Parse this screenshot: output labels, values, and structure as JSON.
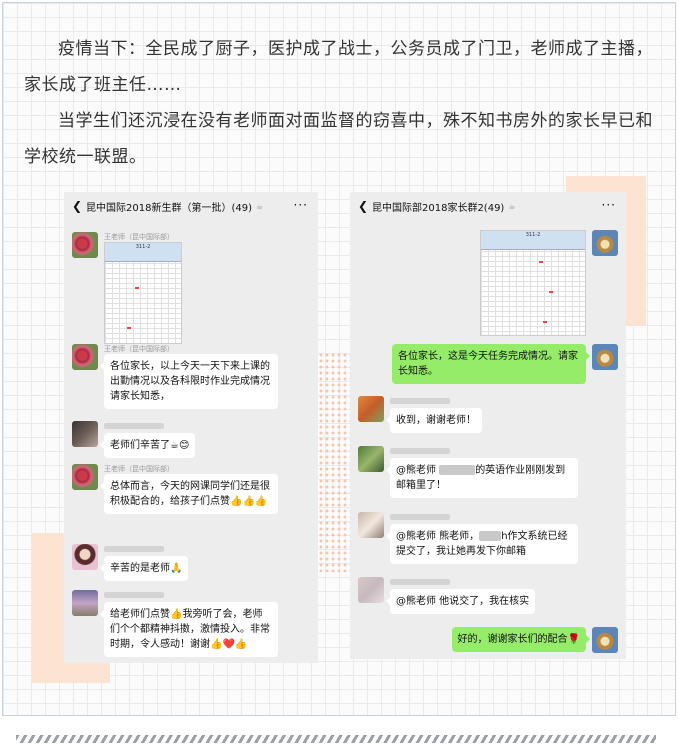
{
  "intro": {
    "para1": "疫情当下：全民成了厨子，医护成了战士，公务员成了门卫，老师成了主播，家长成了班主任……",
    "para2": "当学生们还沉浸在没有老师面对面监督的窃喜中，殊不知书房外的家长早已和学校统一联盟。"
  },
  "left_chat": {
    "title": "昆中国际2018新生群（第一批）(49)",
    "sheet_title": "311-2",
    "messages": [
      {
        "sender": "王老师（昆中国际部）",
        "text": ""
      },
      {
        "sender": "王老师（昆中国际部）",
        "text": "各位家长，以上今天一天下来上课的出勤情况以及各科限时作业完成情况请家长知悉，"
      },
      {
        "sender": "",
        "text": "老师们辛苦了☕😊"
      },
      {
        "sender": "王老师（昆中国际部）",
        "text": "总体而言，今天的网课同学们还是很积极配合的，给孩子们点赞👍👍👍"
      },
      {
        "sender": "",
        "text": "辛苦的是老师🙏"
      },
      {
        "sender": "",
        "text": "给老师们点赞👍我旁听了会，老师们个个都精神抖擞，激情投入。非常时期，令人感动！谢谢👍❤️👍"
      }
    ]
  },
  "right_chat": {
    "title": "昆中国际部2018家长群2(49)",
    "sheet_title": "311-2",
    "messages": [
      {
        "sender": "",
        "text": "各位家长，这是今天任务完成情况。请家长知悉。"
      },
      {
        "sender": "",
        "text": "收到，谢谢老师！"
      },
      {
        "sender": "",
        "text_a": "@熊老师 ",
        "text_b": "的英语作业刚刚发到邮箱里了！"
      },
      {
        "sender": "",
        "text_a": "@熊老师  熊老师，",
        "text_b": "h作文系统已经提交了，我让她再发下你邮箱"
      },
      {
        "sender": "",
        "text": "@熊老师  他说交了，我在核实"
      },
      {
        "sender": "",
        "text": "好的，谢谢家长们的配合🌹"
      }
    ]
  },
  "icons": {
    "back": "chevron-left-icon",
    "more": "more-dots-icon",
    "mute": "mute-bell-icon"
  },
  "colors": {
    "wechat_bg": "#ededed",
    "sent_bubble": "#95ec69",
    "received_bubble": "#ffffff",
    "deco_pink": "#fde3d2"
  }
}
